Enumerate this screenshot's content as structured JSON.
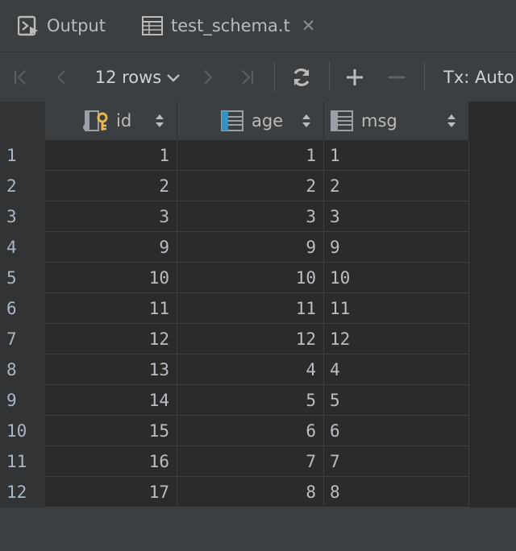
{
  "tabs": [
    {
      "label": "Output",
      "icon": "console-output-icon"
    },
    {
      "label": "test_schema.t",
      "icon": "table-icon"
    }
  ],
  "toolbar": {
    "rows_label": "12 rows",
    "tx_label": "Tx: Auto"
  },
  "columns": [
    {
      "name": "id",
      "icon": "primary-key-column-icon"
    },
    {
      "name": "age",
      "icon": "indexed-column-icon"
    },
    {
      "name": "msg",
      "icon": "column-icon"
    }
  ],
  "rows": [
    {
      "n": "1",
      "id": "1",
      "age": "1",
      "msg": "1"
    },
    {
      "n": "2",
      "id": "2",
      "age": "2",
      "msg": "2"
    },
    {
      "n": "3",
      "id": "3",
      "age": "3",
      "msg": "3"
    },
    {
      "n": "4",
      "id": "9",
      "age": "9",
      "msg": "9"
    },
    {
      "n": "5",
      "id": "10",
      "age": "10",
      "msg": "10"
    },
    {
      "n": "6",
      "id": "11",
      "age": "11",
      "msg": "11"
    },
    {
      "n": "7",
      "id": "12",
      "age": "12",
      "msg": "12"
    },
    {
      "n": "8",
      "id": "13",
      "age": "4",
      "msg": "4"
    },
    {
      "n": "9",
      "id": "14",
      "age": "5",
      "msg": "5"
    },
    {
      "n": "10",
      "id": "15",
      "age": "6",
      "msg": "6"
    },
    {
      "n": "11",
      "id": "16",
      "age": "7",
      "msg": "7"
    },
    {
      "n": "12",
      "id": "17",
      "age": "8",
      "msg": "8"
    }
  ],
  "colors": {
    "accent": "#3592c4",
    "key": "#e8b84a"
  }
}
